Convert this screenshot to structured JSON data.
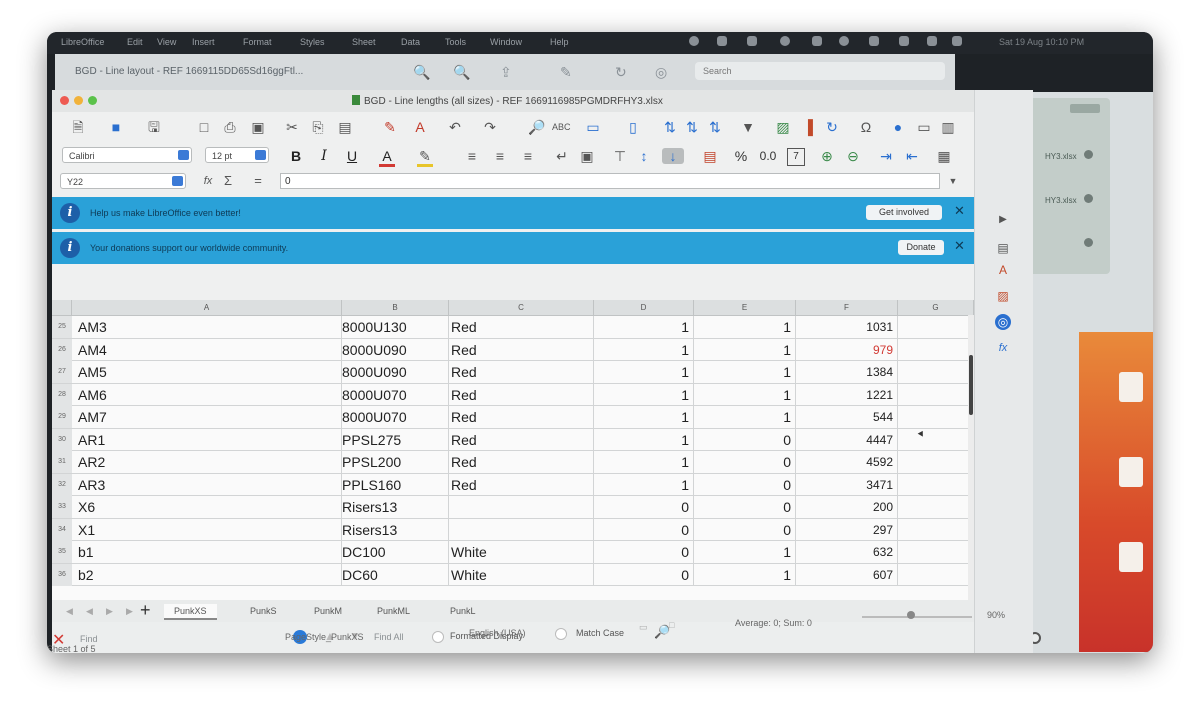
{
  "menubar": {
    "items": [
      "LibreOffice",
      "Edit",
      "View",
      "Insert",
      "Format",
      "Styles",
      "Sheet",
      "Data",
      "Tools",
      "Window",
      "Help"
    ],
    "clock": "Sat 19 Aug 10:10 PM"
  },
  "background_window": {
    "title": "BGD - Line layout - REF 1669115DD65Sd16ggFtl...",
    "search_placeholder": "Search"
  },
  "window": {
    "title": "BGD - Line lengths (all sizes) - REF 1669116985PGMDRFHY3.xlsx"
  },
  "formatting": {
    "font_name": "Calibri",
    "font_size": "12 pt",
    "number_format_symbols": [
      "%",
      "0.0"
    ]
  },
  "formula_bar": {
    "cell_ref": "Y22",
    "value": "0"
  },
  "infobars": [
    {
      "text": "Help us make LibreOffice even better!",
      "button": "Get involved"
    },
    {
      "text": "Your donations support our worldwide community.",
      "button": "Donate"
    }
  ],
  "columns": [
    "A",
    "B",
    "C",
    "D",
    "E",
    "F",
    "G"
  ],
  "rows": [
    {
      "num": "25",
      "a": "AM3",
      "b": "8000U130",
      "c": "Red",
      "d": "1",
      "e": "1",
      "f": "1031"
    },
    {
      "num": "26",
      "a": "AM4",
      "b": "8000U090",
      "c": "Red",
      "d": "1",
      "e": "1",
      "f": "979"
    },
    {
      "num": "27",
      "a": "AM5",
      "b": "8000U090",
      "c": "Red",
      "d": "1",
      "e": "1",
      "f": "1384"
    },
    {
      "num": "28",
      "a": "AM6",
      "b": "8000U070",
      "c": "Red",
      "d": "1",
      "e": "1",
      "f": "1221"
    },
    {
      "num": "29",
      "a": "AM7",
      "b": "8000U070",
      "c": "Red",
      "d": "1",
      "e": "1",
      "f": "544"
    },
    {
      "num": "30",
      "a": "AR1",
      "b": "PPSL275",
      "c": "Red",
      "d": "1",
      "e": "0",
      "f": "4447"
    },
    {
      "num": "31",
      "a": "AR2",
      "b": "PPSL200",
      "c": "Red",
      "d": "1",
      "e": "0",
      "f": "4592"
    },
    {
      "num": "32",
      "a": "AR3",
      "b": "PPLS160",
      "c": "Red",
      "d": "1",
      "e": "0",
      "f": "3471"
    },
    {
      "num": "33",
      "a": "X6",
      "b": "Risers13",
      "c": "",
      "d": "0",
      "e": "0",
      "f": "200"
    },
    {
      "num": "34",
      "a": "X1",
      "b": "Risers13",
      "c": "",
      "d": "0",
      "e": "0",
      "f": "297"
    },
    {
      "num": "35",
      "a": "b1",
      "b": "DC100",
      "c": "White",
      "d": "0",
      "e": "1",
      "f": "632"
    },
    {
      "num": "36",
      "a": "b2",
      "b": "DC60",
      "c": "White",
      "d": "0",
      "e": "1",
      "f": "607"
    }
  ],
  "highlight_color": "#d23a34",
  "sheet_tabs": [
    "PunkXS",
    "PunkS",
    "PunkM",
    "PunkML",
    "PunkL"
  ],
  "active_tab": "PunkXS",
  "find": {
    "placeholder": "Find",
    "find_all": "Find All",
    "formatted_display": "Formatted Display",
    "match_case": "Match Case"
  },
  "status": {
    "sheet": "Sheet 1 of 5",
    "page_style": "PageStyle_PunkXS",
    "language": "English (USA)",
    "summary": "Average: 0; Sum: 0",
    "zoom": "90%"
  },
  "right_panel": {
    "items": [
      "HY3.xlsx",
      "HY3.xlsx"
    ]
  }
}
